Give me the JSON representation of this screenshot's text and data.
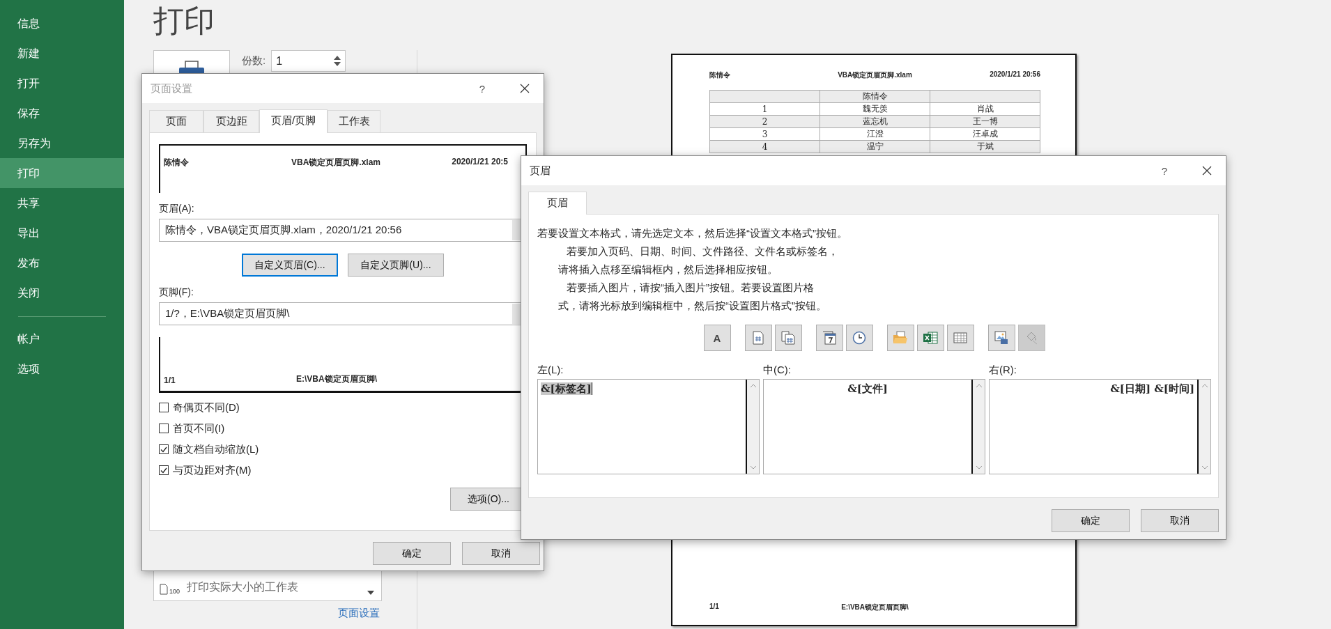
{
  "backstage": {
    "nav_items": [
      {
        "label": "信息",
        "selected": false
      },
      {
        "label": "新建",
        "selected": false
      },
      {
        "label": "打开",
        "selected": false
      },
      {
        "label": "保存",
        "selected": false
      },
      {
        "label": "另存为",
        "selected": false
      },
      {
        "label": "打印",
        "selected": true
      },
      {
        "label": "共享",
        "selected": false
      },
      {
        "label": "导出",
        "selected": false
      },
      {
        "label": "发布",
        "selected": false
      },
      {
        "label": "关闭",
        "selected": false
      }
    ],
    "nav_bottom_items": [
      {
        "label": "帐户",
        "selected": false
      },
      {
        "label": "选项",
        "selected": false
      }
    ],
    "title": "打印",
    "copies": {
      "label": "份数:",
      "value": "1"
    },
    "scaling": {
      "icon_text": "100",
      "description": "打印实际大小的工作表"
    },
    "page_setup_link": "页面设置"
  },
  "preview_page": {
    "header": [
      "陈情令",
      "VBA锁定页眉页脚.xlam",
      "2020/1/21 20:56"
    ],
    "table_rows": [
      [
        "",
        "陈情令",
        ""
      ],
      [
        "1",
        "魏无羡",
        "肖战"
      ],
      [
        "2",
        "蓝忘机",
        "王一博"
      ],
      [
        "3",
        "江澄",
        "汪卓成"
      ],
      [
        "4",
        "温宁",
        "于斌"
      ]
    ],
    "footer": [
      "1/1",
      "E:\\VBA锁定页眉页脚\\"
    ]
  },
  "page_setup_dialog": {
    "title": "页面设置",
    "help": "?",
    "tabs": [
      {
        "label": "页面",
        "selected": false
      },
      {
        "label": "页边距",
        "selected": false
      },
      {
        "label": "页眉/页脚",
        "selected": true
      },
      {
        "label": "工作表",
        "selected": false
      }
    ],
    "header_preview": [
      "陈情令",
      "VBA锁定页眉页脚.xlam",
      "2020/1/21 20:5"
    ],
    "header_label": "页眉(A):",
    "header_value": "陈情令，VBA锁定页眉页脚.xlam，2020/1/21 20:56",
    "custom_buttons": [
      {
        "label": "自定义页眉(C)...",
        "focused": true
      },
      {
        "label": "自定义页脚(U)...",
        "focused": false
      }
    ],
    "footer_label": "页脚(F):",
    "footer_value": "1/?，E:\\VBA锁定页眉页脚\\",
    "footer_preview": [
      "1/1",
      "E:\\VBA锁定页眉页脚\\"
    ],
    "checkboxes": [
      {
        "label": "奇偶页不同(D)",
        "checked": false
      },
      {
        "label": "首页不同(I)",
        "checked": false
      },
      {
        "label": "随文档自动缩放(L)",
        "checked": true
      },
      {
        "label": "与页边距对齐(M)",
        "checked": true
      }
    ],
    "options_button": "选项(O)...",
    "ok": "确定",
    "cancel": "取消"
  },
  "header_dialog": {
    "title": "页眉",
    "help": "?",
    "tab": "页眉",
    "instructions": [
      "若要设置文本格式，请先选定文本，然后选择“设置文本格式”按钮。",
      "若要加入页码、日期、时间、文件路径、文件名或标签名，",
      "请将插入点移至编辑框内，然后选择相应按钮。",
      "若要插入图片，请按“插入图片”按钮。若要设置图片格",
      "式，请将光标放到编辑框中，然后按“设置图片格式”按钮。"
    ],
    "toolbar_groups": [
      [
        {
          "kind": "format-text",
          "label": "A",
          "disabled": false
        }
      ],
      [
        {
          "kind": "page-number",
          "disabled": false
        },
        {
          "kind": "page-count",
          "disabled": false
        }
      ],
      [
        {
          "kind": "date",
          "disabled": false
        },
        {
          "kind": "time",
          "disabled": false
        }
      ],
      [
        {
          "kind": "file-path",
          "disabled": false
        },
        {
          "kind": "file-name",
          "disabled": false
        },
        {
          "kind": "sheet-name",
          "disabled": false
        }
      ],
      [
        {
          "kind": "picture",
          "disabled": false
        },
        {
          "kind": "format-picture",
          "disabled": true
        }
      ]
    ],
    "sections": [
      {
        "label": "左(L):",
        "content": "&[标签名]",
        "highlighted": true
      },
      {
        "label": "中(C):",
        "content": "&[文件]",
        "highlighted": false
      },
      {
        "label": "右(R):",
        "content": "&[日期] &[时间]",
        "highlighted": false
      }
    ],
    "ok": "确定",
    "cancel": "取消"
  }
}
